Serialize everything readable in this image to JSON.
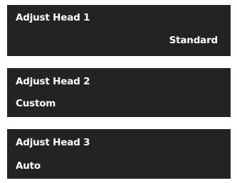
{
  "panels": [
    {
      "title": "Adjust Head 1",
      "value": "Standard",
      "value_align": "right"
    },
    {
      "title": "Adjust Head 2",
      "value": "Custom",
      "value_align": "left"
    },
    {
      "title": "Adjust Head 3",
      "value": "Auto",
      "value_align": "left"
    }
  ],
  "colors": {
    "panel_background": "#232323",
    "text": "#ffffff",
    "page_background": "#ffffff"
  }
}
